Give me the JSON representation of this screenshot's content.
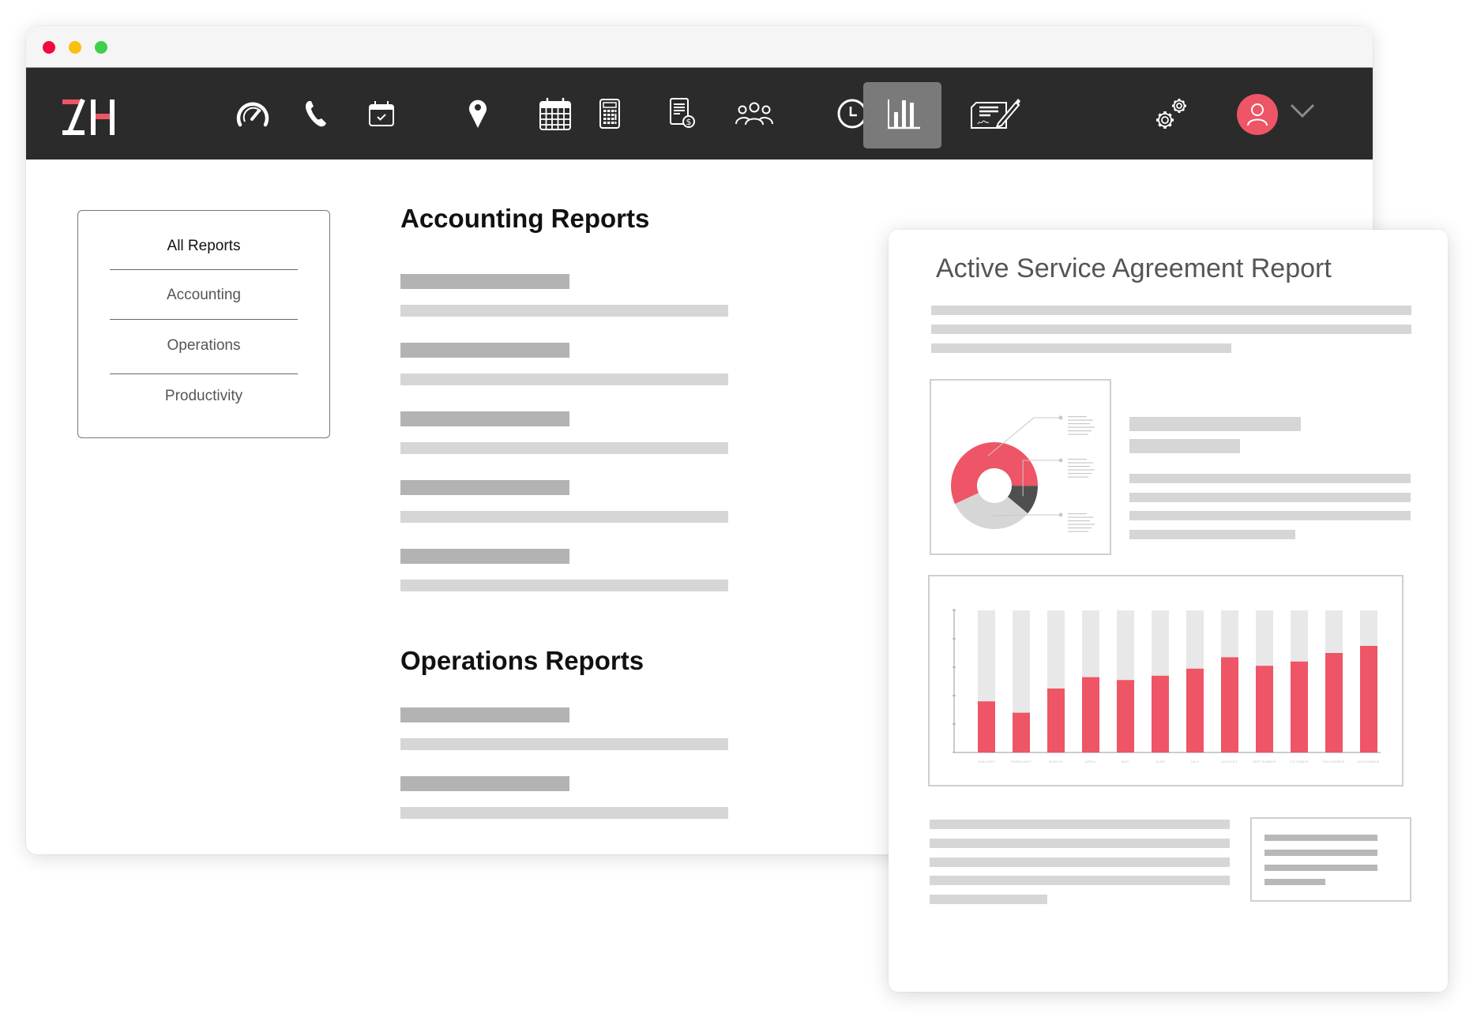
{
  "window": {
    "traffic_lights": [
      "close",
      "minimize",
      "maximize"
    ]
  },
  "navbar": {
    "logo_text": "ZH",
    "brand_color": "#ee5566",
    "background": "#2b2b2b",
    "active_item": "reports",
    "items": [
      {
        "id": "dashboard",
        "icon": "speedometer-icon"
      },
      {
        "id": "calls",
        "icon": "phone-icon"
      },
      {
        "id": "scheduling",
        "icon": "calendar-check-icon"
      },
      {
        "id": "locations",
        "icon": "map-pin-icon"
      },
      {
        "id": "calendar",
        "icon": "calendar-grid-icon"
      },
      {
        "id": "accounting",
        "icon": "calculator-icon"
      },
      {
        "id": "invoices",
        "icon": "invoice-dollar-icon"
      },
      {
        "id": "customers",
        "icon": "team-icon"
      },
      {
        "id": "timesheets",
        "icon": "clock-icon"
      },
      {
        "id": "reports",
        "icon": "bar-chart-icon"
      },
      {
        "id": "agreements",
        "icon": "signed-contract-icon"
      }
    ],
    "settings_icon": "gears-icon",
    "user_icon": "user-avatar-icon",
    "menu_icon": "chevron-down-icon"
  },
  "sidebar": {
    "items": [
      {
        "label": "All Reports",
        "active": true
      },
      {
        "label": "Accounting",
        "active": false
      },
      {
        "label": "Operations",
        "active": false
      },
      {
        "label": "Productivity",
        "active": false
      }
    ]
  },
  "main": {
    "sections": [
      {
        "title": "Accounting Reports",
        "placeholder_rows": 5
      },
      {
        "title": "Operations Reports",
        "placeholder_rows": 2
      }
    ]
  },
  "report_preview": {
    "title": "Active Service Agreement Report",
    "colors": {
      "accent": "#ee5566",
      "dark": "#4f4f4f",
      "light": "#d6d6d6",
      "track": "#e8e8e8"
    }
  },
  "chart_data": [
    {
      "type": "pie",
      "variant": "donut",
      "title": "",
      "slices": [
        {
          "label": "",
          "value": 57,
          "color": "#ee5566"
        },
        {
          "label": "",
          "value": 11,
          "color": "#4f4f4f"
        },
        {
          "label": "",
          "value": 32,
          "color": "#d6d6d6"
        }
      ],
      "legend": "right"
    },
    {
      "type": "bar",
      "variant": "stacked-progress",
      "title": "",
      "categories": [
        "January",
        "February",
        "March",
        "April",
        "May",
        "June",
        "July",
        "August",
        "September",
        "October",
        "November",
        "December"
      ],
      "series": [
        {
          "name": "value",
          "values": [
            0.36,
            0.28,
            0.45,
            0.53,
            0.51,
            0.54,
            0.59,
            0.67,
            0.61,
            0.64,
            0.7,
            0.75
          ],
          "color": "#ee5566"
        },
        {
          "name": "remaining",
          "values": [
            0.64,
            0.72,
            0.55,
            0.47,
            0.49,
            0.46,
            0.41,
            0.33,
            0.39,
            0.36,
            0.3,
            0.25
          ],
          "color": "#e8e8e8"
        }
      ],
      "ylim": [
        0,
        1
      ],
      "y_ticks": 6,
      "xlabel": "",
      "ylabel": "",
      "grid": false
    }
  ]
}
